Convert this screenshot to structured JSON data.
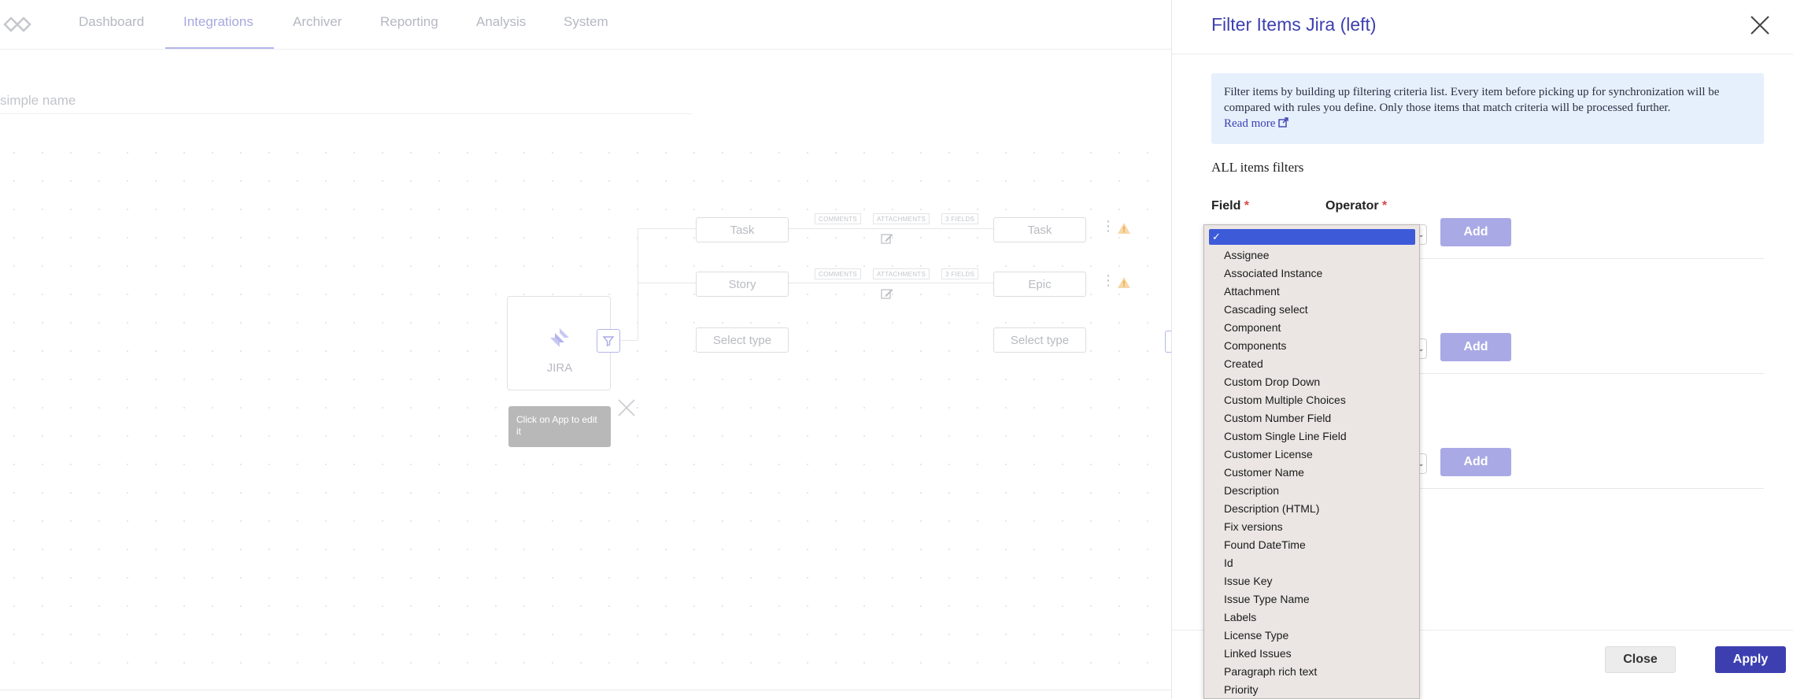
{
  "nav": {
    "items": [
      "Dashboard",
      "Integrations",
      "Archiver",
      "Reporting",
      "Analysis",
      "System"
    ],
    "active": "Integrations"
  },
  "integration": {
    "name_placeholder": "simple name"
  },
  "flow": {
    "source_types": [
      "Task",
      "Story",
      "Select type"
    ],
    "target_types": [
      "Task",
      "Epic",
      "Select type"
    ],
    "tags": [
      "COMMENTS",
      "ATTACHMENTS",
      "3 FIELDS"
    ],
    "app_label": "JIRA",
    "tooltip": "Click on App to edit it"
  },
  "panel": {
    "title": "Filter Items Jira (left)",
    "info_text": "Filter items by building up filtering criteria list. Every item before picking up for synchronization will be compared with rules you define. Only those items that match criteria will be processed further.",
    "read_more": "Read more",
    "section_title": "ALL items filters",
    "field_label": "Field",
    "operator_label": "Operator",
    "required_mark": "*",
    "add_label": "Add",
    "close_label": "Close",
    "apply_label": "Apply"
  },
  "dropdown": {
    "selected_mark": "✓",
    "options": [
      "Assignee",
      "Associated Instance",
      "Attachment",
      "Cascading select",
      "Component",
      "Components",
      "Created",
      "Custom Drop Down",
      "Custom Multiple Choices",
      "Custom Number Field",
      "Custom Single Line Field",
      "Customer License",
      "Customer Name",
      "Description",
      "Description (HTML)",
      "Fix versions",
      "Found DateTime",
      "Id",
      "Issue Key",
      "Issue Type Name",
      "Labels",
      "License Type",
      "Linked Issues",
      "Paragraph rich text",
      "Priority"
    ]
  },
  "colors": {
    "accent": "#3d3fb1",
    "accent_light": "#a9a9e6",
    "info_bg": "#e6f0fc",
    "required": "#d94848"
  }
}
